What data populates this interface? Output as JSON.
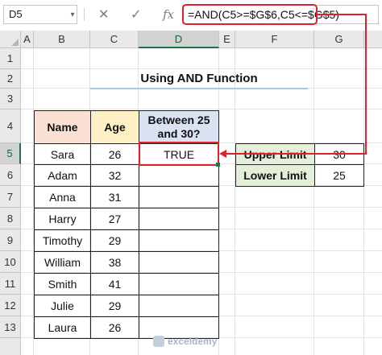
{
  "formula_bar": {
    "name_box": "D5",
    "dropdown_glyph": "▾",
    "cancel_glyph": "✕",
    "enter_glyph": "✓",
    "fx_label": "fx",
    "formula": "=AND(C5>=$G$6,C5<=$G$5)"
  },
  "columns": [
    "A",
    "B",
    "C",
    "D",
    "E",
    "F",
    "G"
  ],
  "rows": [
    "1",
    "2",
    "3",
    "4",
    "5",
    "6",
    "7",
    "8",
    "9",
    "10",
    "11",
    "12",
    "13"
  ],
  "selected_cell": "D5",
  "title": "Using AND Function",
  "table": {
    "headers": {
      "name": "Name",
      "age": "Age",
      "between": "Between 25 and 30?"
    },
    "rows": [
      {
        "name": "Sara",
        "age": "26",
        "result": "TRUE"
      },
      {
        "name": "Adam",
        "age": "32",
        "result": ""
      },
      {
        "name": "Anna",
        "age": "31",
        "result": ""
      },
      {
        "name": "Harry",
        "age": "27",
        "result": ""
      },
      {
        "name": "Timothy",
        "age": "29",
        "result": ""
      },
      {
        "name": "William",
        "age": "38",
        "result": ""
      },
      {
        "name": "Smith",
        "age": "41",
        "result": ""
      },
      {
        "name": "Julie",
        "age": "29",
        "result": ""
      },
      {
        "name": "Laura",
        "age": "26",
        "result": ""
      }
    ]
  },
  "limits": {
    "upper_label": "Upper Limit",
    "upper_value": "30",
    "lower_label": "Lower Limit",
    "lower_value": "25"
  },
  "watermark": {
    "text": "exceldemy",
    "icon": "exceldemy-logo-icon"
  },
  "colors": {
    "accent_red": "#e0202a",
    "excel_green": "#217346",
    "name_header_bg": "#fbe1d3",
    "age_header_bg": "#fdf0c5",
    "between_header_bg": "#dbe3f2",
    "limit_label_bg": "#e3efd9",
    "title_underline": "#a9c9e4"
  }
}
